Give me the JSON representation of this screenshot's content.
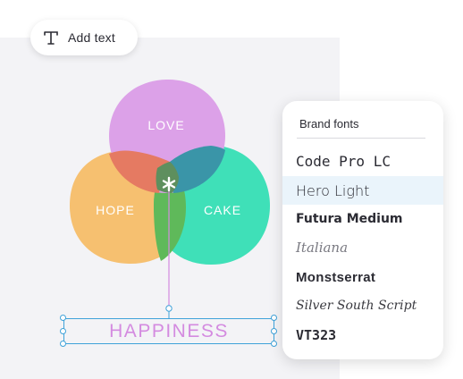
{
  "toolbar": {
    "add_text_label": "Add text",
    "add_text_icon": "text-icon"
  },
  "canvas": {
    "circles": [
      {
        "label": "LOVE",
        "color": "#dca1e8"
      },
      {
        "label": "HOPE",
        "color": "#f6c070"
      },
      {
        "label": "CAKE",
        "color": "#3fe0b8"
      }
    ],
    "center_icon": "asterisk-icon",
    "selected_text": "HAPPINESS",
    "selected_text_color": "#d48be0",
    "selection_color": "#3fa2d9"
  },
  "font_panel": {
    "title": "Brand fonts",
    "fonts": [
      {
        "name": "Code Pro LC",
        "selected": false
      },
      {
        "name": "Hero Light",
        "selected": true
      },
      {
        "name": "Futura Medium",
        "selected": false
      },
      {
        "name": "Italiana",
        "selected": false
      },
      {
        "name": "Monstserrat",
        "selected": false
      },
      {
        "name": "Silver South Script",
        "selected": false
      },
      {
        "name": "VT323",
        "selected": false
      }
    ]
  }
}
